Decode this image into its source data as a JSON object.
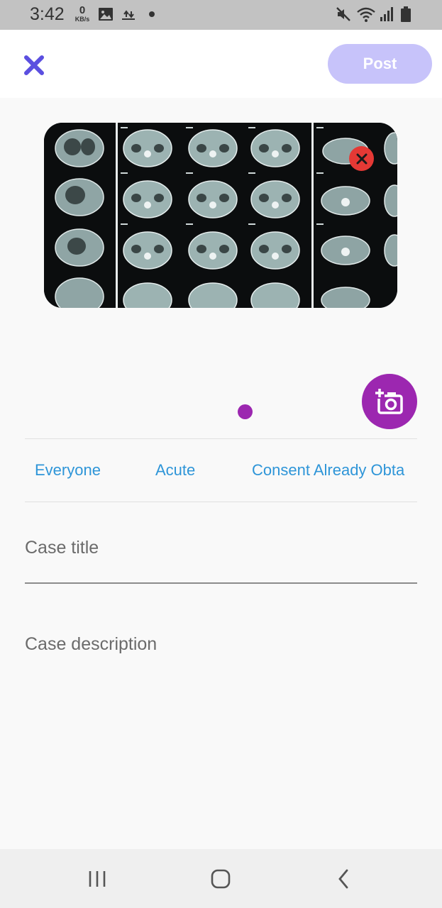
{
  "status_bar": {
    "time": "3:42",
    "net_speed_value": "0",
    "net_speed_unit": "KB/s",
    "icons": [
      "gallery-icon",
      "cloud-transfer-icon",
      "dot-icon",
      "mute-icon",
      "wifi-icon",
      "signal-icon",
      "battery-icon"
    ]
  },
  "app_bar": {
    "close_icon": "close-icon",
    "post_label": "Post",
    "post_color": "#c7c3fa",
    "close_color": "#5b4fe0"
  },
  "media": {
    "image_alt": "CT scan image",
    "remove_icon": "close-icon",
    "add_photo_icon": "add-photo-icon",
    "accent_color": "#9c27b0",
    "pager_count": 1,
    "pager_selected": 1
  },
  "options": [
    {
      "label": "Everyone"
    },
    {
      "label": "Acute"
    },
    {
      "label": "Consent Already Obta"
    }
  ],
  "form": {
    "title_placeholder": "Case title",
    "description_placeholder": "Case description"
  },
  "nav_bar": {
    "icons": [
      "recent-apps-icon",
      "home-icon",
      "back-icon"
    ]
  }
}
